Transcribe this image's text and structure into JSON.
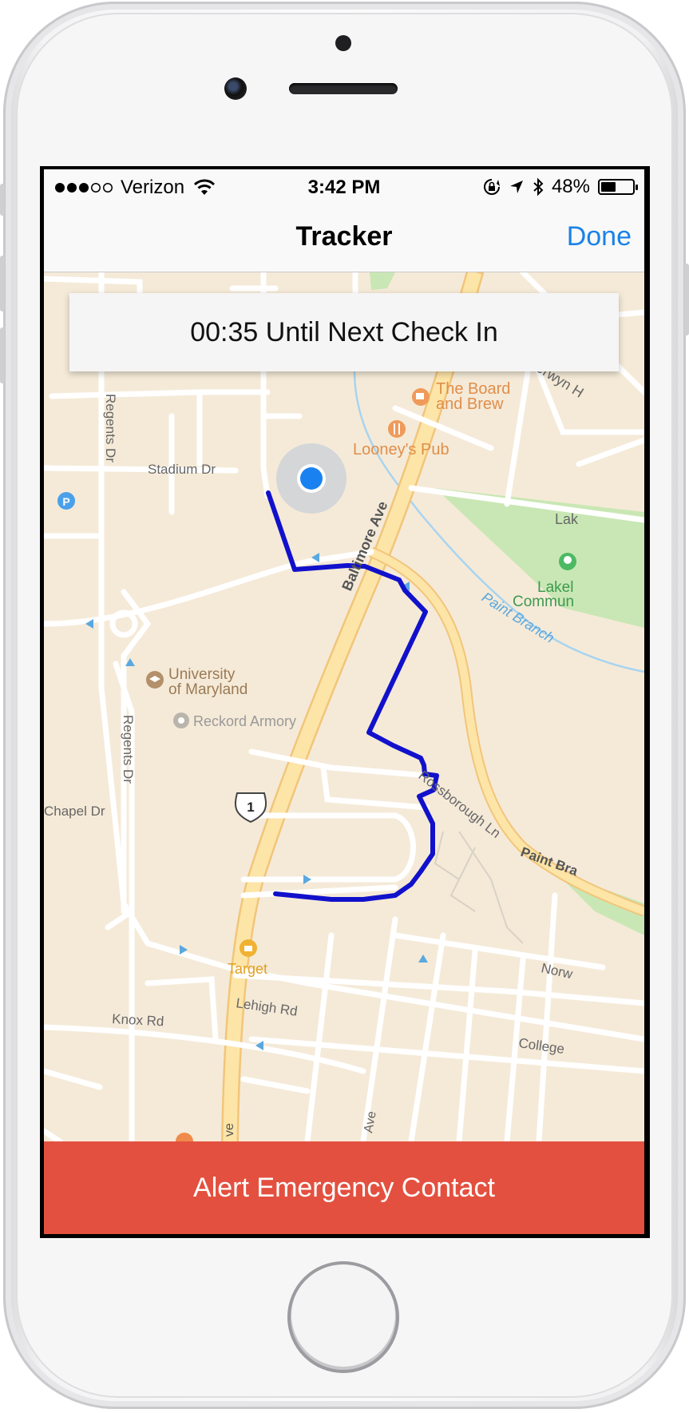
{
  "status_bar": {
    "carrier": "Verizon",
    "time": "3:42 PM",
    "battery": "48%",
    "battery_level": 0.48
  },
  "nav": {
    "title": "Tracker",
    "done_label": "Done"
  },
  "banner": {
    "text": "00:35 Until Next Check In"
  },
  "map": {
    "labels": {
      "berwyn": "Berwyn H",
      "board_and_brew_1": "The Board",
      "board_and_brew_2": "and Brew",
      "looneys": "Looney's Pub",
      "regents_dr_top": "Regents Dr",
      "stadium_dr": "Stadium Dr",
      "baltimore_ave": "Baltimore Ave",
      "lak": "Lak",
      "lakel_1": "Lakel",
      "lakel_2": "Commun",
      "paint_branch_stream": "Paint Branch",
      "university_1": "University",
      "university_2": "of Maryland",
      "reckord": "Reckord Armory",
      "regents_dr_bottom": "Regents Dr",
      "chapel_dr": "Chapel Dr",
      "route_shield": "1",
      "rossborough": "Rossborough Ln",
      "paint_branch_road": "Paint Bra",
      "norw": "Norw",
      "target": "Target",
      "lehigh": "Lehigh Rd",
      "knox": "Knox Rd",
      "college": "College",
      "ave_partial_1": "ve",
      "ave_partial_2": "Ave",
      "parking": "P"
    },
    "colors": {
      "route": "#1111cc",
      "user_location": "#1a82f0",
      "park": "#c9e7b4",
      "major_road": "#fde5a8",
      "water": "#a8d4f0"
    }
  },
  "alert_button": {
    "label": "Alert Emergency Contact"
  }
}
